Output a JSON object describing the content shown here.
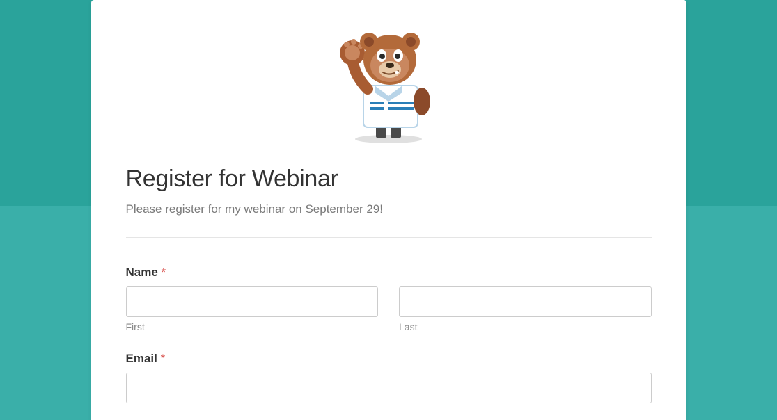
{
  "form": {
    "title": "Register for Webinar",
    "subtitle": "Please register for my webinar on September 29!",
    "fields": {
      "name": {
        "label": "Name",
        "required_mark": "*",
        "first_sublabel": "First",
        "last_sublabel": "Last",
        "first_value": "",
        "last_value": ""
      },
      "email": {
        "label": "Email",
        "required_mark": "*",
        "value": ""
      }
    }
  },
  "mascot": {
    "name": "bear-mascot-icon"
  },
  "colors": {
    "background_top": "#2aa39b",
    "background_bottom": "#3aafa9",
    "card": "#ffffff",
    "text_primary": "#333333",
    "text_secondary": "#7a7a7a",
    "required": "#d9534f"
  }
}
